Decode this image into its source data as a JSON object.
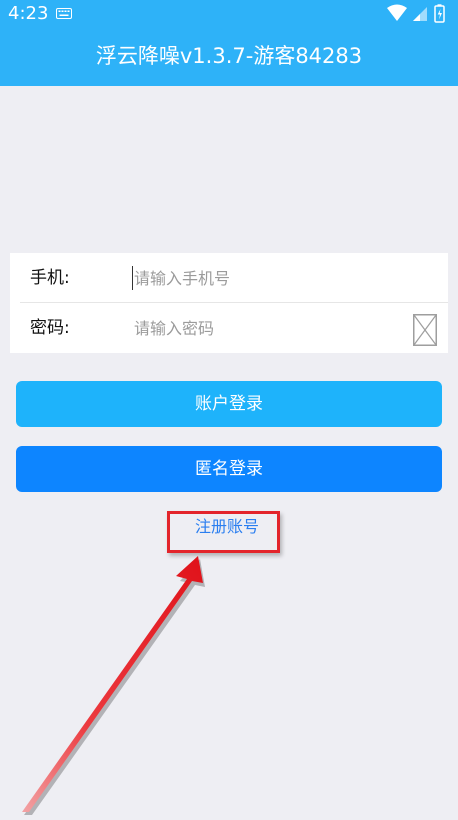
{
  "status_bar": {
    "time": "4:23",
    "icons": [
      "keyboard-icon",
      "wifi-icon",
      "cell-signal-icon",
      "battery-icon"
    ]
  },
  "header": {
    "title": "浮云降噪v1.3.7-游客84283"
  },
  "form": {
    "phone_label": "手机:",
    "phone_placeholder": "请输入手机号",
    "password_label": "密码:",
    "password_placeholder": "请输入密码"
  },
  "buttons": {
    "account_login": "账户登录",
    "anonymous_login": "匿名登录"
  },
  "register_link": "注册账号",
  "colors": {
    "header": "#2eb2f8",
    "account_button": "#1eb3fb",
    "anonymous_button": "#0d85ff",
    "link": "#2a7ef0",
    "annotation": "#e3242b",
    "background": "#eeeef3"
  }
}
